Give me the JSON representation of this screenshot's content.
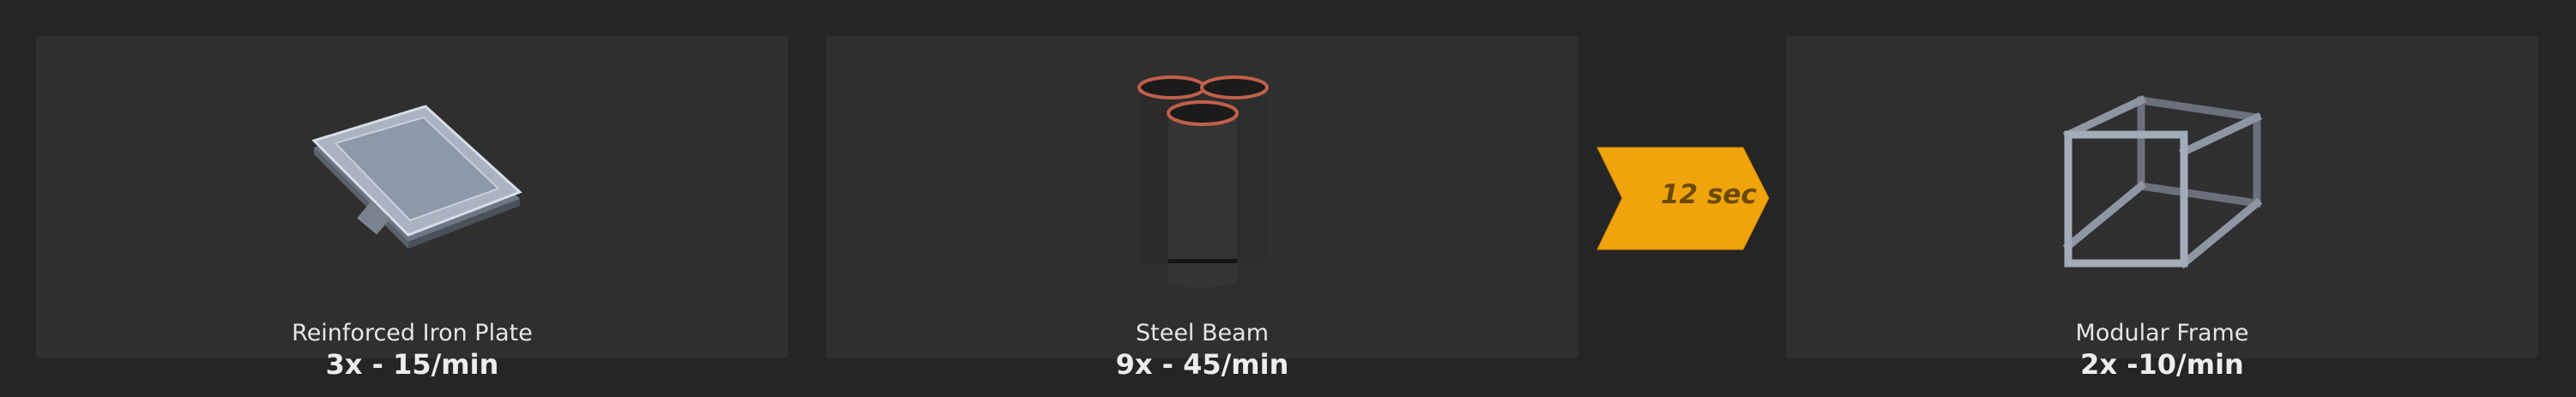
{
  "inputs": [
    {
      "name": "Reinforced Iron Plate",
      "rate": "3x - 15/min",
      "icon": "reinforced-iron-plate-icon"
    },
    {
      "name": "Steel Beam",
      "rate": "9x - 45/min",
      "icon": "steel-beam-icon"
    }
  ],
  "process": {
    "time": "12 sec",
    "color": "#f0a30a"
  },
  "output": {
    "name": "Modular Frame",
    "rate": "2x -10/min",
    "icon": "modular-frame-icon"
  }
}
